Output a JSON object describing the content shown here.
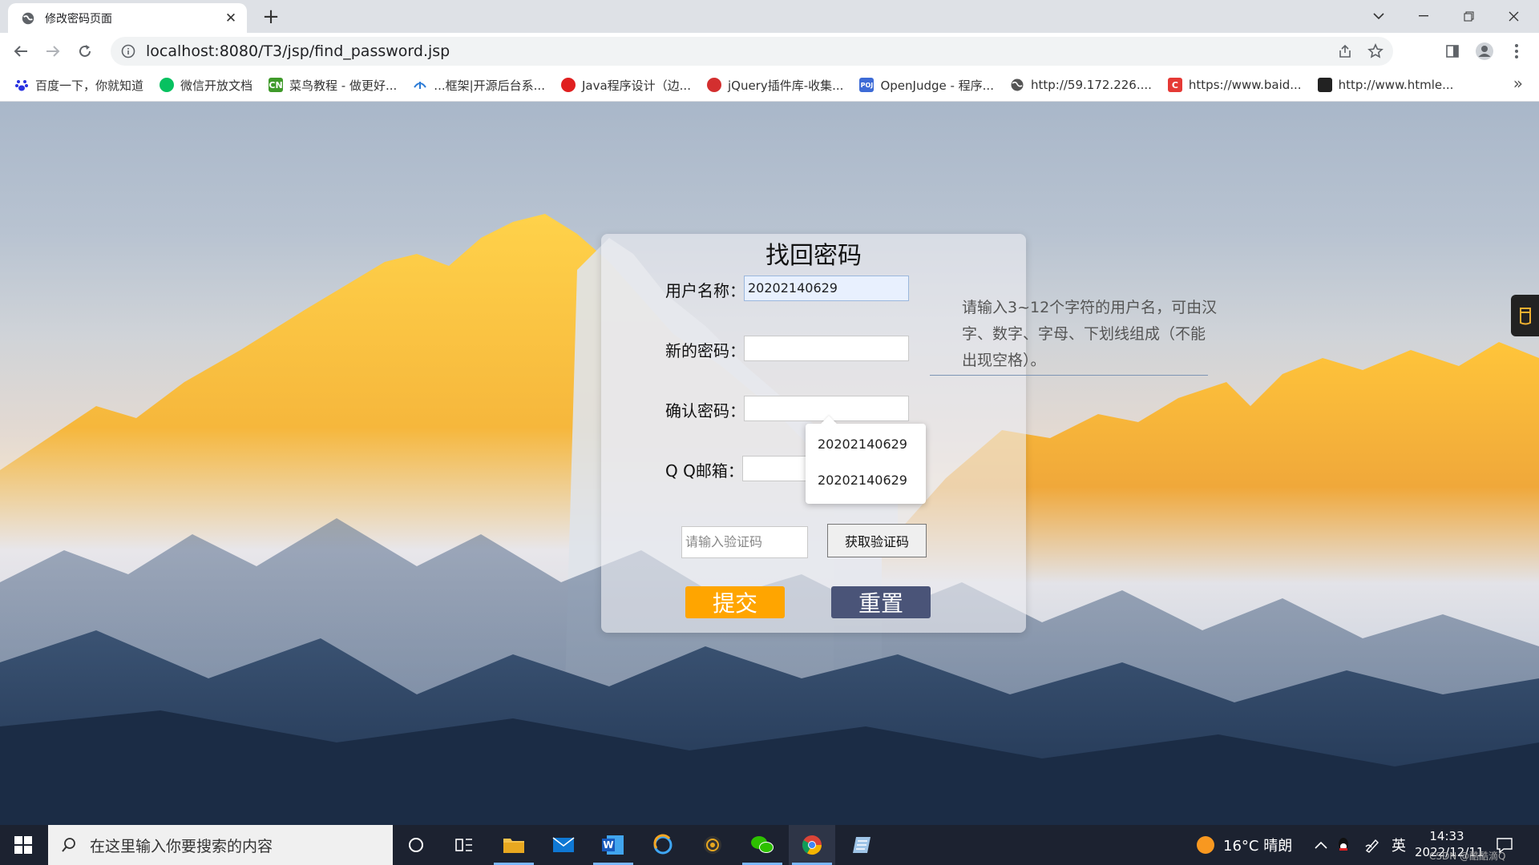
{
  "browser": {
    "tab_title": "修改密码页面",
    "url": "localhost:8080/T3/jsp/find_password.jsp",
    "bookmarks": [
      {
        "label": "百度一下，你就知道",
        "icon": "baidu-paw-icon",
        "color": "#2932e1"
      },
      {
        "label": "微信开放文档",
        "icon": "wechat-icon",
        "color": "#07c160"
      },
      {
        "label": "菜鸟教程 - 做更好...",
        "icon": "runoob-cn-icon",
        "color": "#3f9a2a",
        "badge": "CN"
      },
      {
        "label": "...框架|开源后台系...",
        "icon": "leaf-icon",
        "color": "#2b7bd6"
      },
      {
        "label": "Java程序设计（边...",
        "icon": "java-icon",
        "color": "#e02020"
      },
      {
        "label": "jQuery插件库-收集...",
        "icon": "jquery-icon",
        "color": "#d32f2f"
      },
      {
        "label": "OpenJudge - 程序...",
        "icon": "poj-icon",
        "color": "#3d6bd6",
        "badge": "POJ"
      },
      {
        "label": "http://59.172.226....",
        "icon": "globe-icon",
        "color": "#555555"
      },
      {
        "label": "https://www.baid...",
        "icon": "csdn-c-icon",
        "color": "#e53935",
        "badge": "C"
      },
      {
        "label": "http://www.htmle...",
        "icon": "htmleaf-icon",
        "color": "#222222"
      }
    ]
  },
  "form": {
    "title": "找回密码",
    "username_label": "用户名称：",
    "username_value": "20202140629",
    "new_password_label": "新的密码：",
    "confirm_password_label": "确认密码：",
    "email_label": "Q Q邮箱：",
    "code_placeholder": "请输入验证码",
    "get_code_button": "获取验证码",
    "submit_button": "提交",
    "reset_button": "重置"
  },
  "autocomplete": {
    "options": [
      "20202140629",
      "20202140629"
    ]
  },
  "hint": {
    "text": "请输入3~12个字符的用户名，可由汉字、数字、字母、下划线组成（不能出现空格）。"
  },
  "taskbar": {
    "search_placeholder": "在这里输入你要搜索的内容",
    "weather": "16°C 晴朗",
    "ime": "英",
    "time": "14:33",
    "date": "2022/12/11",
    "watermark": "CSDN @酷酷滴Q"
  },
  "colors": {
    "submit": "#ffa500",
    "reset": "#4a5478",
    "taskbar": "#1c2230"
  }
}
